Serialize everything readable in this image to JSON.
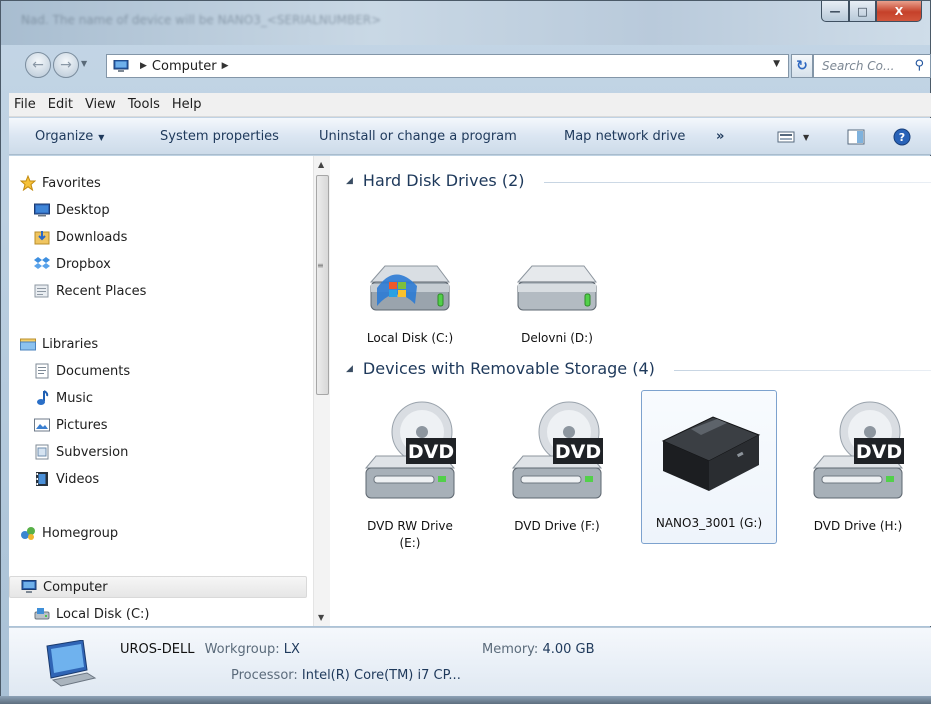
{
  "window": {
    "title_blurred": "Nad. The name of device will be NANO3_<SERIALNUMBER>"
  },
  "address": {
    "crumb": "Computer",
    "search_placeholder": "Search Co..."
  },
  "menu": [
    "File",
    "Edit",
    "View",
    "Tools",
    "Help"
  ],
  "commands": {
    "organize": "Organize",
    "system_properties": "System properties",
    "uninstall": "Uninstall or change a program",
    "map_drive": "Map network drive",
    "more": "»"
  },
  "nav": {
    "favorites": "Favorites",
    "desktop": "Desktop",
    "downloads": "Downloads",
    "dropbox": "Dropbox",
    "recent": "Recent Places",
    "libraries": "Libraries",
    "documents": "Documents",
    "music": "Music",
    "pictures": "Pictures",
    "subversion": "Subversion",
    "videos": "Videos",
    "homegroup": "Homegroup",
    "computer": "Computer",
    "localdisk": "Local Disk (C:)"
  },
  "groups": {
    "hdd": "Hard Disk Drives (2)",
    "removable": "Devices with Removable Storage (4)"
  },
  "drives": {
    "c": "Local Disk (C:)",
    "d": "Delovni (D:)",
    "e1": "DVD RW Drive",
    "e2": "(E:)",
    "f": "DVD Drive (F:)",
    "g": "NANO3_3001 (G:)",
    "h": "DVD Drive (H:)",
    "dvd_badge": "DVD"
  },
  "details": {
    "computer_name": "UROS-DELL",
    "workgroup_label": "Workgroup:",
    "workgroup": "LX",
    "memory_label": "Memory:",
    "memory": "4.00 GB",
    "processor_label": "Processor:",
    "processor": "Intel(R) Core(TM) i7 CP..."
  }
}
